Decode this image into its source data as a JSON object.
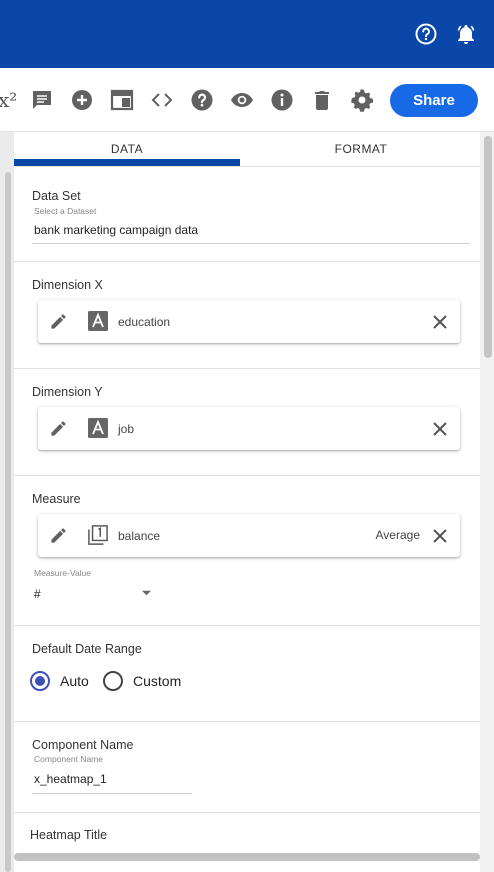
{
  "topbar": {
    "help_icon": "help-circle-icon",
    "notifications_icon": "bell-icon"
  },
  "toolbar": {
    "partial_label": "x²",
    "icons": [
      "comment-icon",
      "add-circle-icon",
      "window-icon",
      "code-icon",
      "help-icon",
      "visibility-icon",
      "info-icon",
      "delete-icon",
      "settings-icon"
    ],
    "share_label": "Share"
  },
  "tabs": {
    "data": "DATA",
    "format": "FORMAT",
    "active": "DATA"
  },
  "dataset": {
    "label": "Data Set",
    "sublabel": "Select a Dataset",
    "value": "bank marketing campaign data"
  },
  "dimension_x": {
    "label": "Dimension X",
    "field": "education",
    "type_icon": "text-type-icon"
  },
  "dimension_y": {
    "label": "Dimension Y",
    "field": "job",
    "type_icon": "text-type-icon"
  },
  "measure": {
    "label": "Measure",
    "field": "balance",
    "aggregation": "Average",
    "type_icon": "numeric-type-icon",
    "value_label": "Measure-Value",
    "value_selected": "#"
  },
  "date_range": {
    "label": "Default Date Range",
    "options": [
      "Auto",
      "Custom"
    ],
    "selected": "Auto"
  },
  "component_name": {
    "label": "Component Name",
    "sublabel": "Component Name",
    "value": "x_heatmap_1"
  },
  "heatmap_title": {
    "label": "Heatmap Title"
  },
  "colors": {
    "brand": "#0a47a9",
    "share": "#1769e6",
    "radio": "#3f51b5"
  }
}
